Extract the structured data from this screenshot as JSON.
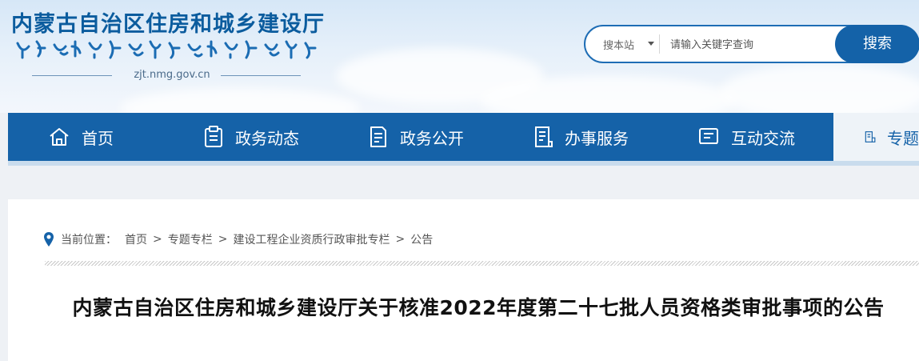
{
  "header": {
    "site_title": "内蒙古自治区住房和城乡建设厅",
    "domain": "zjt.nmg.gov.cn"
  },
  "search": {
    "scope_label": "搜本站",
    "placeholder": "请输入关键字查询",
    "button_label": "搜索"
  },
  "nav": {
    "items": [
      {
        "label": "首页",
        "icon": "home-icon"
      },
      {
        "label": "政务动态",
        "icon": "clipboard-icon"
      },
      {
        "label": "政务公开",
        "icon": "document-icon"
      },
      {
        "label": "办事服务",
        "icon": "service-icon"
      },
      {
        "label": "互动交流",
        "icon": "chat-icon"
      },
      {
        "label": "专题",
        "icon": "topic-icon"
      }
    ]
  },
  "breadcrumb": {
    "prefix": "当前位置：",
    "items": [
      "首页",
      "专题专栏",
      "建设工程企业资质行政审批专栏",
      "公告"
    ],
    "separator": ">"
  },
  "article": {
    "title": "内蒙古自治区住房和城乡建设厅关于核准2022年度第二十七批人员资格类审批事项的公告"
  },
  "colors": {
    "nav_bg": "#1562a8",
    "brand_blue": "#0b5c9e",
    "search_border": "#1e6db5"
  }
}
